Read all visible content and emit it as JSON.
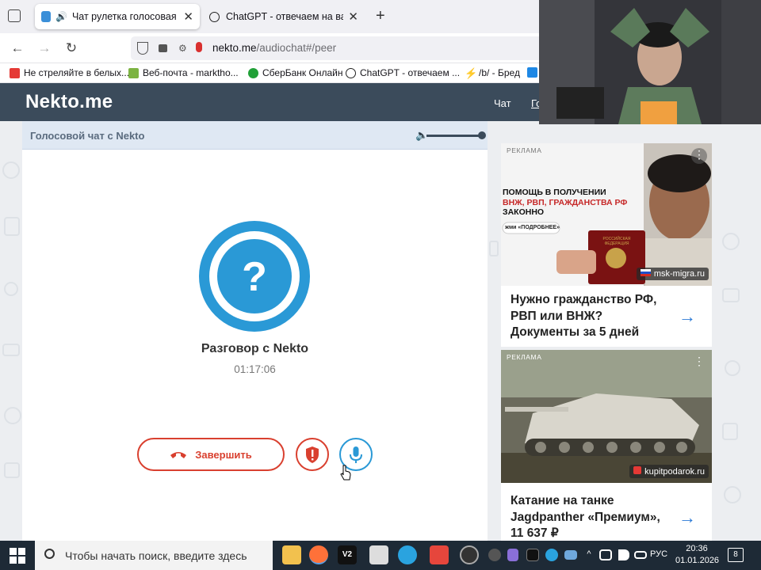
{
  "browser": {
    "tabs": [
      {
        "title": "Чат рулетка голосовая —  ",
        "active": true
      },
      {
        "title": "ChatGPT - отвечаем на вакан",
        "active": false
      }
    ],
    "new_tab_label": "+",
    "url_domain": "nekto.me",
    "url_path": "/audiochat#/peer",
    "bookmarks": [
      {
        "label": "Не стреляйте в белых...",
        "icon_color": "#e53935"
      },
      {
        "label": "Веб-почта - marktho...",
        "icon_color": "#7cb342"
      },
      {
        "label": "СберБанк Онлайн",
        "icon_color": "#21a038"
      },
      {
        "label": "ChatGPT - отвечаем ...",
        "icon_color": "#222222"
      },
      {
        "label": "/b/ - Бред",
        "icon_color": "#ff8c00"
      }
    ]
  },
  "site": {
    "logo": "Nekto.me",
    "nav_links": [
      "Чат",
      "Го"
    ],
    "panel_title": "Голосовой чат с Nekto",
    "volume_level": 1.0,
    "avatar_glyph": "?",
    "chat_name": "Разговор с Nekto",
    "timer": "01:17:06",
    "end_button_label": "Завершить",
    "colors": {
      "header": "#3b4b5b",
      "accent_blue": "#2a99d6",
      "danger_red": "#d9402f"
    }
  },
  "ads": [
    {
      "label": "РЕКЛАМА",
      "headline_line1": "ПОМОЩЬ В ПОЛУЧЕНИИ",
      "headline_line2": "ВНЖ, РВП, ГРАЖДАНСТВА РФ",
      "headline_line3": "ЗАКОННО",
      "cta": "жми «ПОДРОБНЕЕ»",
      "passport_text": "РОССИЙСКАЯ ФЕДЕРАЦИЯ",
      "domain": "msk-migra.ru",
      "title": "Нужно гражданство РФ, РВП или ВНЖ? Документы за 5 дней"
    },
    {
      "label": "РЕКЛАМА",
      "domain": "kupitpodarok.ru",
      "title": "Катание на танке Jagdpanther «Премиум», 11 637 ₽"
    }
  ],
  "taskbar": {
    "search_placeholder": "Чтобы начать поиск, введите здесь",
    "lang": "РУС",
    "time": "20:36",
    "date": "01.01.2026",
    "notifications": "8",
    "v2_label": "V2"
  }
}
